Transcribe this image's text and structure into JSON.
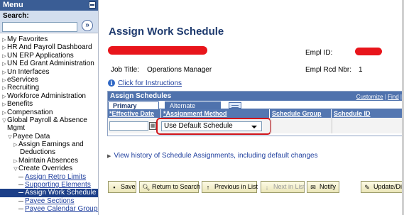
{
  "menu": {
    "title": "Menu",
    "search_label": "Search:",
    "search_value": "",
    "search_go": "»",
    "items": [
      {
        "label": "My Favorites",
        "kind": "folder"
      },
      {
        "label": "HR And Payroll Dashboard",
        "kind": "folder"
      },
      {
        "label": "UN ERP Applications",
        "kind": "folder"
      },
      {
        "label": "UN Ed Grant Administration",
        "kind": "folder"
      },
      {
        "label": "Un Interfaces",
        "kind": "folder"
      },
      {
        "label": "eServices",
        "kind": "folder"
      },
      {
        "label": "Recruiting",
        "kind": "folder"
      },
      {
        "label": "Workforce Administration",
        "kind": "folder"
      },
      {
        "label": "Benefits",
        "kind": "folder"
      },
      {
        "label": "Compensation",
        "kind": "folder"
      },
      {
        "label": "Global Payroll & Absence",
        "kind": "open-folder"
      },
      {
        "label": "Mgmt",
        "kind": "continuation"
      },
      {
        "label": "Payee Data",
        "kind": "open-folder-l1"
      },
      {
        "label": "Assign Earnings and",
        "kind": "folder-l2"
      },
      {
        "label": "Deductions",
        "kind": "continuation-l2"
      },
      {
        "label": "Maintain Absences",
        "kind": "folder-l2"
      },
      {
        "label": "Create Overrides",
        "kind": "open-folder-l2"
      },
      {
        "label": "Assign Retro Limits",
        "kind": "link"
      },
      {
        "label": "Supporting Elements",
        "kind": "link"
      },
      {
        "label": "Assign Work Schedule",
        "kind": "link-selected"
      },
      {
        "label": "Payee Sections",
        "kind": "link"
      },
      {
        "label": "Payee Calendar Groups",
        "kind": "link"
      }
    ]
  },
  "page": {
    "title": "Assign Work Schedule",
    "empl_id_label": "Empl ID:",
    "job_title_label": "Job Title:",
    "job_title_value": "Operations Manager",
    "empl_rcd_label": "Empl Rcd Nbr:",
    "empl_rcd_value": "1",
    "instructions_link": "Click for Instructions",
    "redaction_color": "#e8151b"
  },
  "grid": {
    "title": "Assign Schedules",
    "tools": {
      "customize": "Customize",
      "sep1": " | ",
      "find": "Find",
      "sep2": " | "
    },
    "tabs": {
      "primary": "Primary Details",
      "alternate": "Alternate Details"
    },
    "columns": {
      "effective_date": "*Effective Date",
      "assignment_method": "*Assignment Method",
      "schedule_group": "Schedule Group",
      "schedule_id": "Schedule ID"
    },
    "row": {
      "effective_date": "",
      "assignment_method": "Use Default Schedule"
    }
  },
  "history_link": "View history of Schedule Assignments, including default changes",
  "toolbar": {
    "save": "Save",
    "return": "Return to Search",
    "previous": "Previous in List",
    "next": "Next in List",
    "notify": "Notify",
    "update": "Update/Disp"
  },
  "colors": {
    "header_blue": "#3a5d95",
    "grid_blue": "#4f72ad",
    "highlight_red": "#d0141a",
    "selected_menu": "#1c3f88"
  }
}
